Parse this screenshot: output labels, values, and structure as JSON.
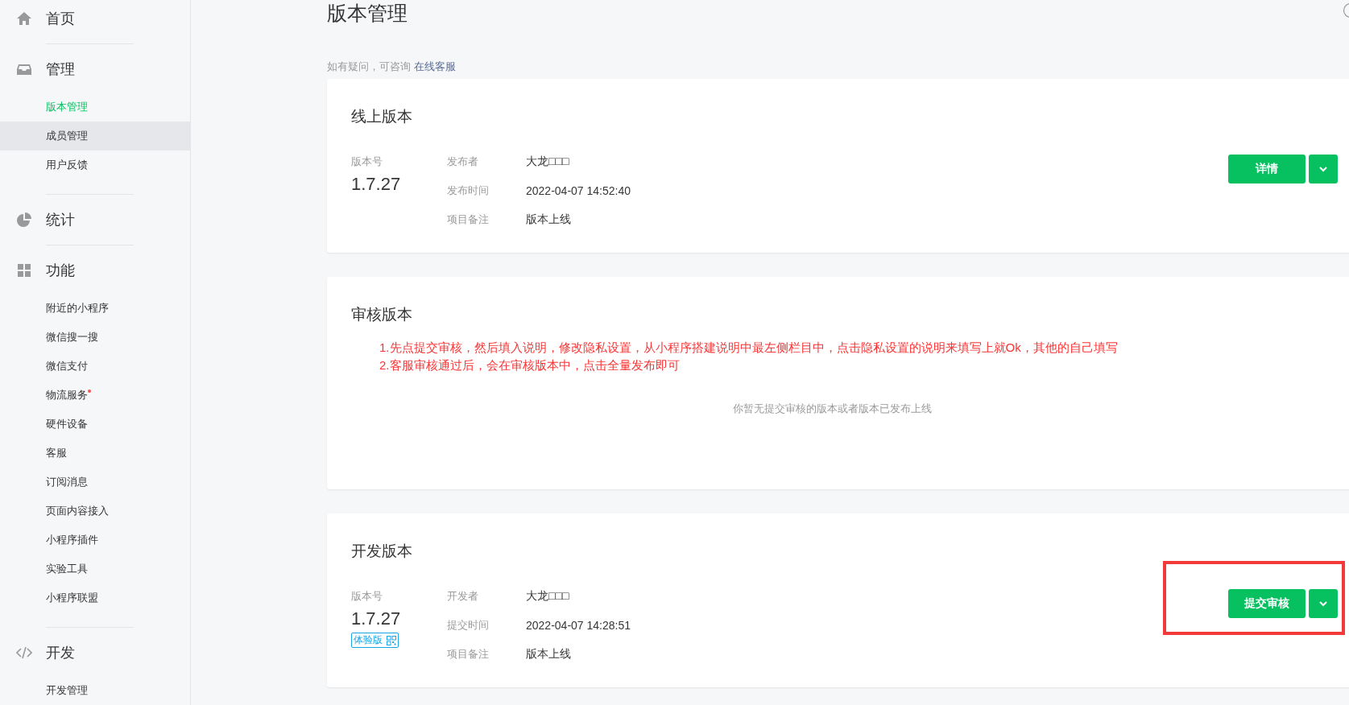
{
  "sidebar": {
    "sections": [
      {
        "title": "首页"
      },
      {
        "title": "管理",
        "items": [
          {
            "label": "版本管理",
            "selected": true,
            "highlighted": false,
            "dot": false
          },
          {
            "label": "成员管理",
            "selected": false,
            "highlighted": true,
            "dot": false
          },
          {
            "label": "用户反馈",
            "selected": false,
            "highlighted": false,
            "dot": false
          }
        ]
      },
      {
        "title": "统计"
      },
      {
        "title": "功能",
        "items": [
          {
            "label": "附近的小程序",
            "selected": false,
            "highlighted": false,
            "dot": false
          },
          {
            "label": "微信搜一搜",
            "selected": false,
            "highlighted": false,
            "dot": false
          },
          {
            "label": "微信支付",
            "selected": false,
            "highlighted": false,
            "dot": false
          },
          {
            "label": "物流服务",
            "selected": false,
            "highlighted": false,
            "dot": true
          },
          {
            "label": "硬件设备",
            "selected": false,
            "highlighted": false,
            "dot": false
          },
          {
            "label": "客服",
            "selected": false,
            "highlighted": false,
            "dot": false
          },
          {
            "label": "订阅消息",
            "selected": false,
            "highlighted": false,
            "dot": false
          },
          {
            "label": "页面内容接入",
            "selected": false,
            "highlighted": false,
            "dot": false
          },
          {
            "label": "小程序插件",
            "selected": false,
            "highlighted": false,
            "dot": false
          },
          {
            "label": "实验工具",
            "selected": false,
            "highlighted": false,
            "dot": false
          },
          {
            "label": "小程序联盟",
            "selected": false,
            "highlighted": false,
            "dot": false
          }
        ]
      },
      {
        "title": "开发",
        "items": [
          {
            "label": "开发管理",
            "selected": false,
            "highlighted": false,
            "dot": false
          }
        ]
      }
    ]
  },
  "page": {
    "title": "版本管理",
    "hint": "如有疑问，可咨询",
    "hint_link": "在线客服"
  },
  "cards": [
    {
      "kind": "version",
      "title": "线上版本",
      "version_label": "版本号",
      "version": "1.7.27",
      "fields": [
        {
          "label": "发布者",
          "value": "大龙□□□"
        },
        {
          "label": "发布时间",
          "value": "2022-04-07 14:52:40"
        },
        {
          "label": "项目备注",
          "value": "版本上线"
        }
      ],
      "primary_button": "详情",
      "highlighted": false
    },
    {
      "kind": "empty",
      "title": "审核版本",
      "notes": [
        "1.先点提交审核，然后填入说明，修改隐私设置，从小程序搭建说明中最左侧栏目中，点击隐私设置的说明来填写上就Ok，其他的自己填写",
        "2.客服审核通过后，会在审核版本中，点击全量发布即可"
      ],
      "empty_text": "你暂无提交审核的版本或者版本已发布上线"
    },
    {
      "kind": "version",
      "title": "开发版本",
      "version_label": "版本号",
      "version": "1.7.27",
      "badge": "体验版",
      "fields": [
        {
          "label": "开发者",
          "value": "大龙□□□"
        },
        {
          "label": "提交时间",
          "value": "2022-04-07 14:28:51"
        },
        {
          "label": "项目备注",
          "value": "版本上线"
        }
      ],
      "primary_button": "提交审核",
      "highlighted": true
    }
  ]
}
